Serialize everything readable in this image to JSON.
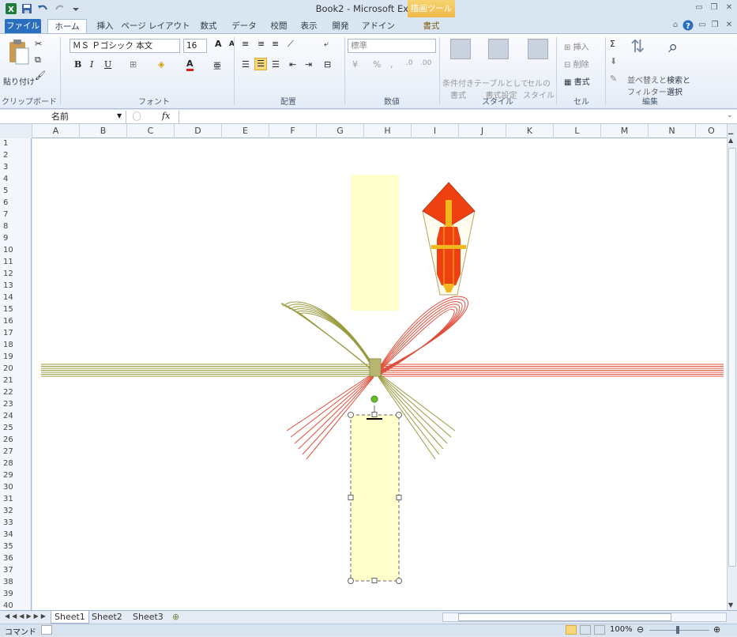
{
  "app": {
    "title": "Book2 - Microsoft Excel",
    "contextual_tab_group": "描画ツール"
  },
  "tabs": [
    {
      "label": "ファイル"
    },
    {
      "label": "ホーム"
    },
    {
      "label": "挿入"
    },
    {
      "label": "ページ レイアウト"
    },
    {
      "label": "数式"
    },
    {
      "label": "データ"
    },
    {
      "label": "校閲"
    },
    {
      "label": "表示"
    },
    {
      "label": "開発"
    },
    {
      "label": "アドイン"
    },
    {
      "label": "書式"
    }
  ],
  "ribbon": {
    "clipboard": {
      "paste": "貼り付け",
      "group": "クリップボード"
    },
    "font": {
      "font_name": "ＭＳ Ｐゴシック 本文",
      "font_size": "16",
      "group": "フォント"
    },
    "alignment": {
      "group": "配置"
    },
    "number": {
      "format": "標準",
      "group": "数値"
    },
    "styles": {
      "conditional": "条件付き\n書式",
      "table": "テーブルとして\n書式設定",
      "cell_style": "セルの\nスタイル",
      "group": "スタイル"
    },
    "cells": {
      "insert": "挿入",
      "delete": "削除",
      "format": "書式",
      "group": "セル"
    },
    "editing": {
      "sort": "並べ替えと\nフィルター",
      "find": "検索と\n選択",
      "group": "編集"
    }
  },
  "formula_bar": {
    "name_box": "名前",
    "fx": "fx",
    "value": ""
  },
  "columns": [
    "A",
    "B",
    "C",
    "D",
    "E",
    "F",
    "G",
    "H",
    "I",
    "J",
    "K",
    "L",
    "M",
    "N",
    "O"
  ],
  "rows": [
    "1",
    "2",
    "3",
    "4",
    "5",
    "6",
    "7",
    "8",
    "9",
    "10",
    "11",
    "12",
    "13",
    "14",
    "15",
    "16",
    "17",
    "18",
    "19",
    "20",
    "21",
    "22",
    "23",
    "24",
    "25",
    "26",
    "27",
    "28",
    "29",
    "30",
    "31",
    "32",
    "33",
    "34",
    "35",
    "36",
    "37",
    "38",
    "39",
    "40"
  ],
  "sheets": [
    "Sheet1",
    "Sheet2",
    "Sheet3"
  ],
  "status": {
    "mode": "コマンド",
    "zoom": "100%"
  },
  "colors": {
    "cord_red": "#e0503c",
    "cord_gold": "#9a9a3e",
    "noshi_red": "#ee4010",
    "noshi_yellow": "#f3b81f",
    "tanzaku": "#ffffcc",
    "accent_blue": "#2a6fbf"
  }
}
